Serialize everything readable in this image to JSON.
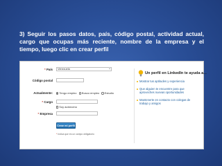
{
  "caption": "3) Seguir los pasos datos, país, código postal, actividad actual, cargo que ocupas más reciente, nombre de la empresa y el tiempo, luego clic en crear perfil",
  "form": {
    "pais_label": "País",
    "pais_value": "Venezuela",
    "codigo_postal_label": "Código postal",
    "actualmente_label": "Actualmente:",
    "radio_options": [
      "Tengo empleo",
      "Busco empleo",
      "Estudio"
    ],
    "cargo_label": "Cargo",
    "autonomo_label": "Soy autónomo",
    "empresa_label": "Empresa",
    "required_mark": "*",
    "submit_label": "Crear mi perfil",
    "required_note": "Indica que es un campo obligatorio"
  },
  "panel": {
    "title": "Un perfil en LinkedIn te ayuda a...",
    "tips": [
      "Mostrar tus aptitudes y experiencia",
      "Que alguien te encuentre para que aproveches nuevas oportunidades",
      "Mantenerte en contacto con colegas de trabajo y amigos"
    ]
  },
  "colors": {
    "background": "#2a4f98",
    "button": "#1f6aa8",
    "link": "#1f5f9e",
    "bulb": "#f0b400"
  },
  "icons": {
    "bulb": "lightbulb-icon"
  }
}
